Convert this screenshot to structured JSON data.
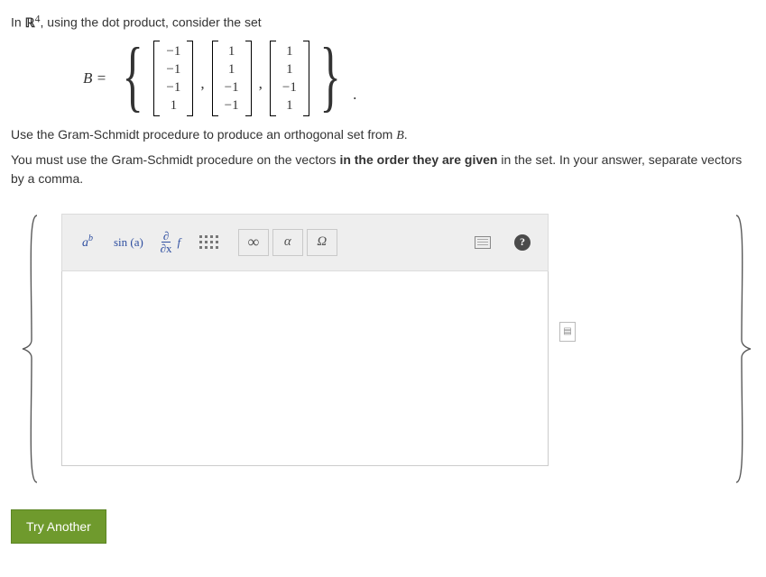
{
  "question": {
    "intro_prefix": "In ",
    "space_R": "ℝ",
    "space_exp": "4",
    "intro_suffix": ", using the dot product, consider the set",
    "set_label": "B =",
    "vectors": [
      [
        "−1",
        "−1",
        "−1",
        "1"
      ],
      [
        "1",
        "1",
        "−1",
        "−1"
      ],
      [
        "1",
        "1",
        "−1",
        "1"
      ]
    ],
    "comma": ",",
    "period": ".",
    "line2_a": "Use the Gram-Schmidt procedure to produce an orthogonal set from ",
    "line2_B": "B",
    "line2_b": ".",
    "line3_a": "You must use the Gram-Schmidt procedure on the vectors ",
    "line3_bold": "in the order they are given",
    "line3_b": " in the set. In your answer, separate vectors by a comma."
  },
  "toolbar": {
    "ab": {
      "a": "a",
      "b": "b"
    },
    "sin": "sin (a)",
    "deriv": {
      "num": "∂",
      "den": "∂x",
      "f": "f"
    },
    "infty": "∞",
    "alpha": "α",
    "omega": "Ω",
    "help": "?"
  },
  "actions": {
    "try_another": "Try Another"
  }
}
